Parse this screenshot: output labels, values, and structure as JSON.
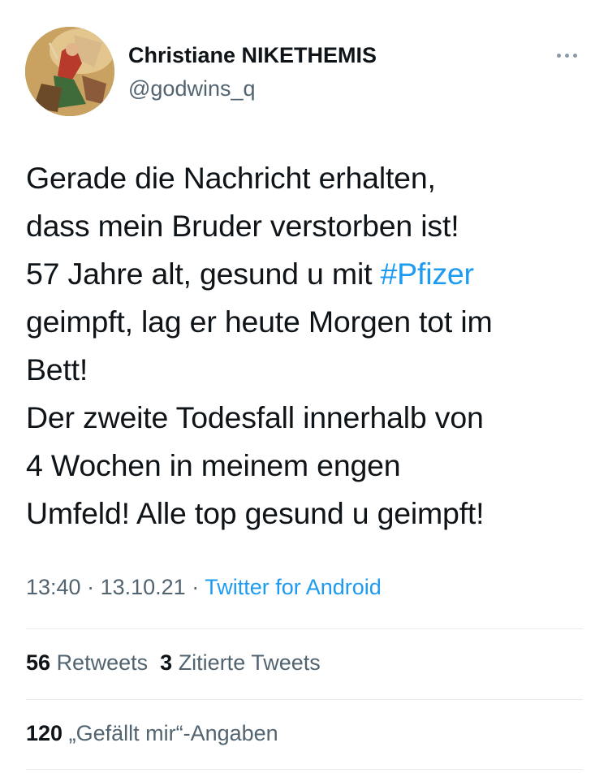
{
  "author": {
    "display_name": "Christiane NIKETHEMIS",
    "handle": "@godwins_q"
  },
  "tweet": {
    "line1": "Gerade die Nachricht erhalten,",
    "line2": "dass mein Bruder verstorben ist!",
    "line3_before": "57 Jahre alt, gesund u mit ",
    "hashtag": "#Pfizer",
    "line4": "geimpft, lag er heute Morgen tot im",
    "line5": "Bett!",
    "line6": "Der zweite Todesfall innerhalb von",
    "line7": "4 Wochen in meinem engen",
    "line8": "Umfeld! Alle top gesund u geimpft!"
  },
  "meta": {
    "time": "13:40",
    "sep1": " · ",
    "date": "13.10.21",
    "sep2": " · ",
    "source": "Twitter for Android"
  },
  "stats": {
    "retweets_count": "56",
    "retweets_label": "Retweets",
    "quotes_count": "3",
    "quotes_label": "Zitierte Tweets",
    "likes_count": "120",
    "likes_label": "„Gefällt mir“-Angaben"
  },
  "colors": {
    "text": "#0f1419",
    "secondary": "#536471",
    "link": "#1d9bf0",
    "divider": "#e6ecf0"
  },
  "icons": {
    "more": "more-options-icon",
    "avatar": "avatar"
  }
}
